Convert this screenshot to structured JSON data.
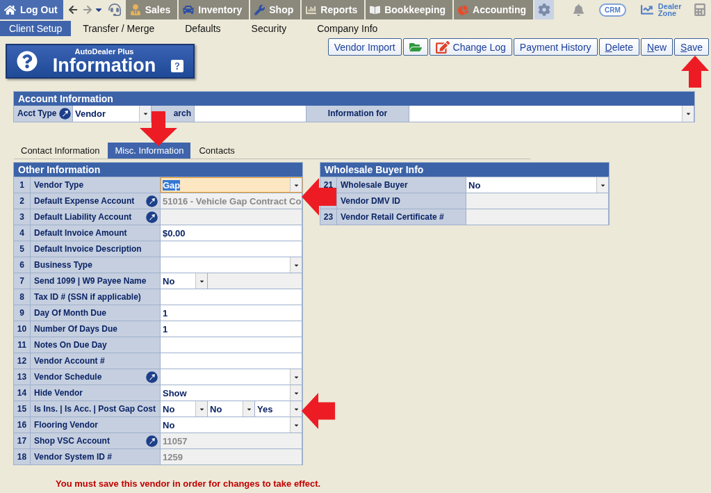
{
  "nav": {
    "logout": "Log Out",
    "modules": [
      {
        "label": "Sales",
        "kind": "sales"
      },
      {
        "label": "Inventory",
        "kind": "inventory"
      },
      {
        "label": "Shop",
        "kind": "shop"
      },
      {
        "label": "Reports",
        "kind": "reports"
      },
      {
        "label": "Bookkeeping",
        "kind": "bookkeeping"
      },
      {
        "label": "Accounting",
        "kind": "accounting"
      }
    ],
    "crm": "CRM",
    "dealer_zone": "Dealer Zone"
  },
  "subnav": [
    {
      "label": "Client Setup",
      "selected": true
    },
    {
      "label": "Transfer / Merge",
      "selected": false
    },
    {
      "label": "Defaults",
      "selected": false
    },
    {
      "label": "Security",
      "selected": false
    },
    {
      "label": "Company Info",
      "selected": false
    }
  ],
  "header": {
    "brand": "AutoDealer Plus",
    "title": "Information"
  },
  "buttons": [
    {
      "kind": "text",
      "rest": "Vendor Import"
    },
    {
      "kind": "folder"
    },
    {
      "kind": "log",
      "rest": "Change Log"
    },
    {
      "kind": "text",
      "rest": "Payment History"
    },
    {
      "kind": "text",
      "key": "D",
      "rest": "elete"
    },
    {
      "kind": "text",
      "key": "N",
      "rest": "ew"
    },
    {
      "kind": "text",
      "key": "S",
      "rest": "ave"
    }
  ],
  "account": {
    "title": "Account Information",
    "acct_type_label": "Acct Type",
    "acct_type": "Vendor",
    "search_label": "arch",
    "info_for_label": "Information for"
  },
  "tabs": [
    {
      "label": "Contact Information",
      "selected": false
    },
    {
      "label": "Misc. Information",
      "selected": true
    },
    {
      "label": "Contacts",
      "selected": false
    }
  ],
  "other": {
    "title": "Other Information",
    "rows": [
      {
        "num": "1",
        "label": "Vendor Type",
        "lookup": false,
        "focused": true,
        "fields": [
          {
            "kind": "select",
            "value": "Gap"
          }
        ]
      },
      {
        "num": "2",
        "label": "Default Expense Account",
        "lookup": true,
        "focused": false,
        "fields": [
          {
            "kind": "readonly",
            "value": "51016 - Vehicle Gap Contract Co"
          }
        ]
      },
      {
        "num": "3",
        "label": "Default Liability Account",
        "lookup": true,
        "focused": false,
        "fields": [
          {
            "kind": "readonly"
          }
        ]
      },
      {
        "num": "4",
        "label": "Default Invoice Amount",
        "lookup": false,
        "focused": false,
        "fields": [
          {
            "kind": "text",
            "value": "$0.00"
          }
        ]
      },
      {
        "num": "5",
        "label": "Default Invoice Description",
        "lookup": false,
        "focused": false,
        "fields": [
          {
            "kind": "text"
          }
        ]
      },
      {
        "num": "6",
        "label": "Business Type",
        "lookup": false,
        "focused": false,
        "fields": [
          {
            "kind": "select"
          }
        ]
      },
      {
        "num": "7",
        "label": "Send 1099 | W9 Payee Name",
        "lookup": false,
        "focused": false,
        "fields": [
          {
            "kind": "select",
            "value": "No"
          },
          {
            "kind": "readonly"
          }
        ]
      },
      {
        "num": "8",
        "label": "Tax ID # (SSN if applicable)",
        "lookup": false,
        "focused": false,
        "fields": [
          {
            "kind": "text"
          }
        ]
      },
      {
        "num": "9",
        "label": "Day Of Month Due",
        "lookup": false,
        "focused": false,
        "fields": [
          {
            "kind": "text",
            "value": "1"
          }
        ]
      },
      {
        "num": "10",
        "label": "Number Of Days Due",
        "lookup": false,
        "focused": false,
        "fields": [
          {
            "kind": "text",
            "value": "1"
          }
        ]
      },
      {
        "num": "11",
        "label": "Notes On Due Day",
        "lookup": false,
        "focused": false,
        "fields": [
          {
            "kind": "text"
          }
        ]
      },
      {
        "num": "12",
        "label": "Vendor Account #",
        "lookup": false,
        "focused": false,
        "fields": [
          {
            "kind": "text"
          }
        ]
      },
      {
        "num": "13",
        "label": "Vendor Schedule",
        "lookup": true,
        "focused": false,
        "fields": [
          {
            "kind": "select"
          }
        ]
      },
      {
        "num": "14",
        "label": "Hide Vendor",
        "lookup": false,
        "focused": false,
        "fields": [
          {
            "kind": "select",
            "value": "Show"
          }
        ]
      },
      {
        "num": "15",
        "label": "Is Ins. | Is Acc. | Post Gap Cost",
        "lookup": false,
        "focused": false,
        "fields": [
          {
            "kind": "select",
            "value": "No"
          },
          {
            "kind": "select",
            "value": "No"
          },
          {
            "kind": "select",
            "value": "Yes"
          }
        ]
      },
      {
        "num": "16",
        "label": "Flooring Vendor",
        "lookup": false,
        "focused": false,
        "fields": [
          {
            "kind": "select",
            "value": "No"
          }
        ]
      },
      {
        "num": "17",
        "label": "Shop VSC Account",
        "lookup": true,
        "focused": false,
        "fields": [
          {
            "kind": "readonly",
            "value": "11057"
          }
        ]
      },
      {
        "num": "18",
        "label": "Vendor System ID #",
        "lookup": false,
        "focused": false,
        "fields": [
          {
            "kind": "readonly",
            "value": "1259"
          }
        ]
      }
    ]
  },
  "wholesale": {
    "title": "Wholesale Buyer Info",
    "rows": [
      {
        "num": "21",
        "label": "Wholesale Buyer",
        "lookup": false,
        "focused": false,
        "fields": [
          {
            "kind": "select",
            "value": "No"
          }
        ]
      },
      {
        "label": "Vendor DMV ID",
        "lookup": false,
        "focused": false,
        "fields": [
          {
            "kind": "readonly"
          }
        ]
      },
      {
        "num": "23",
        "label": "Vendor Retail Certificate #",
        "lookup": false,
        "focused": false,
        "fields": [
          {
            "kind": "readonly"
          }
        ]
      }
    ]
  },
  "message": "You must save this vendor in order for changes to take effect."
}
